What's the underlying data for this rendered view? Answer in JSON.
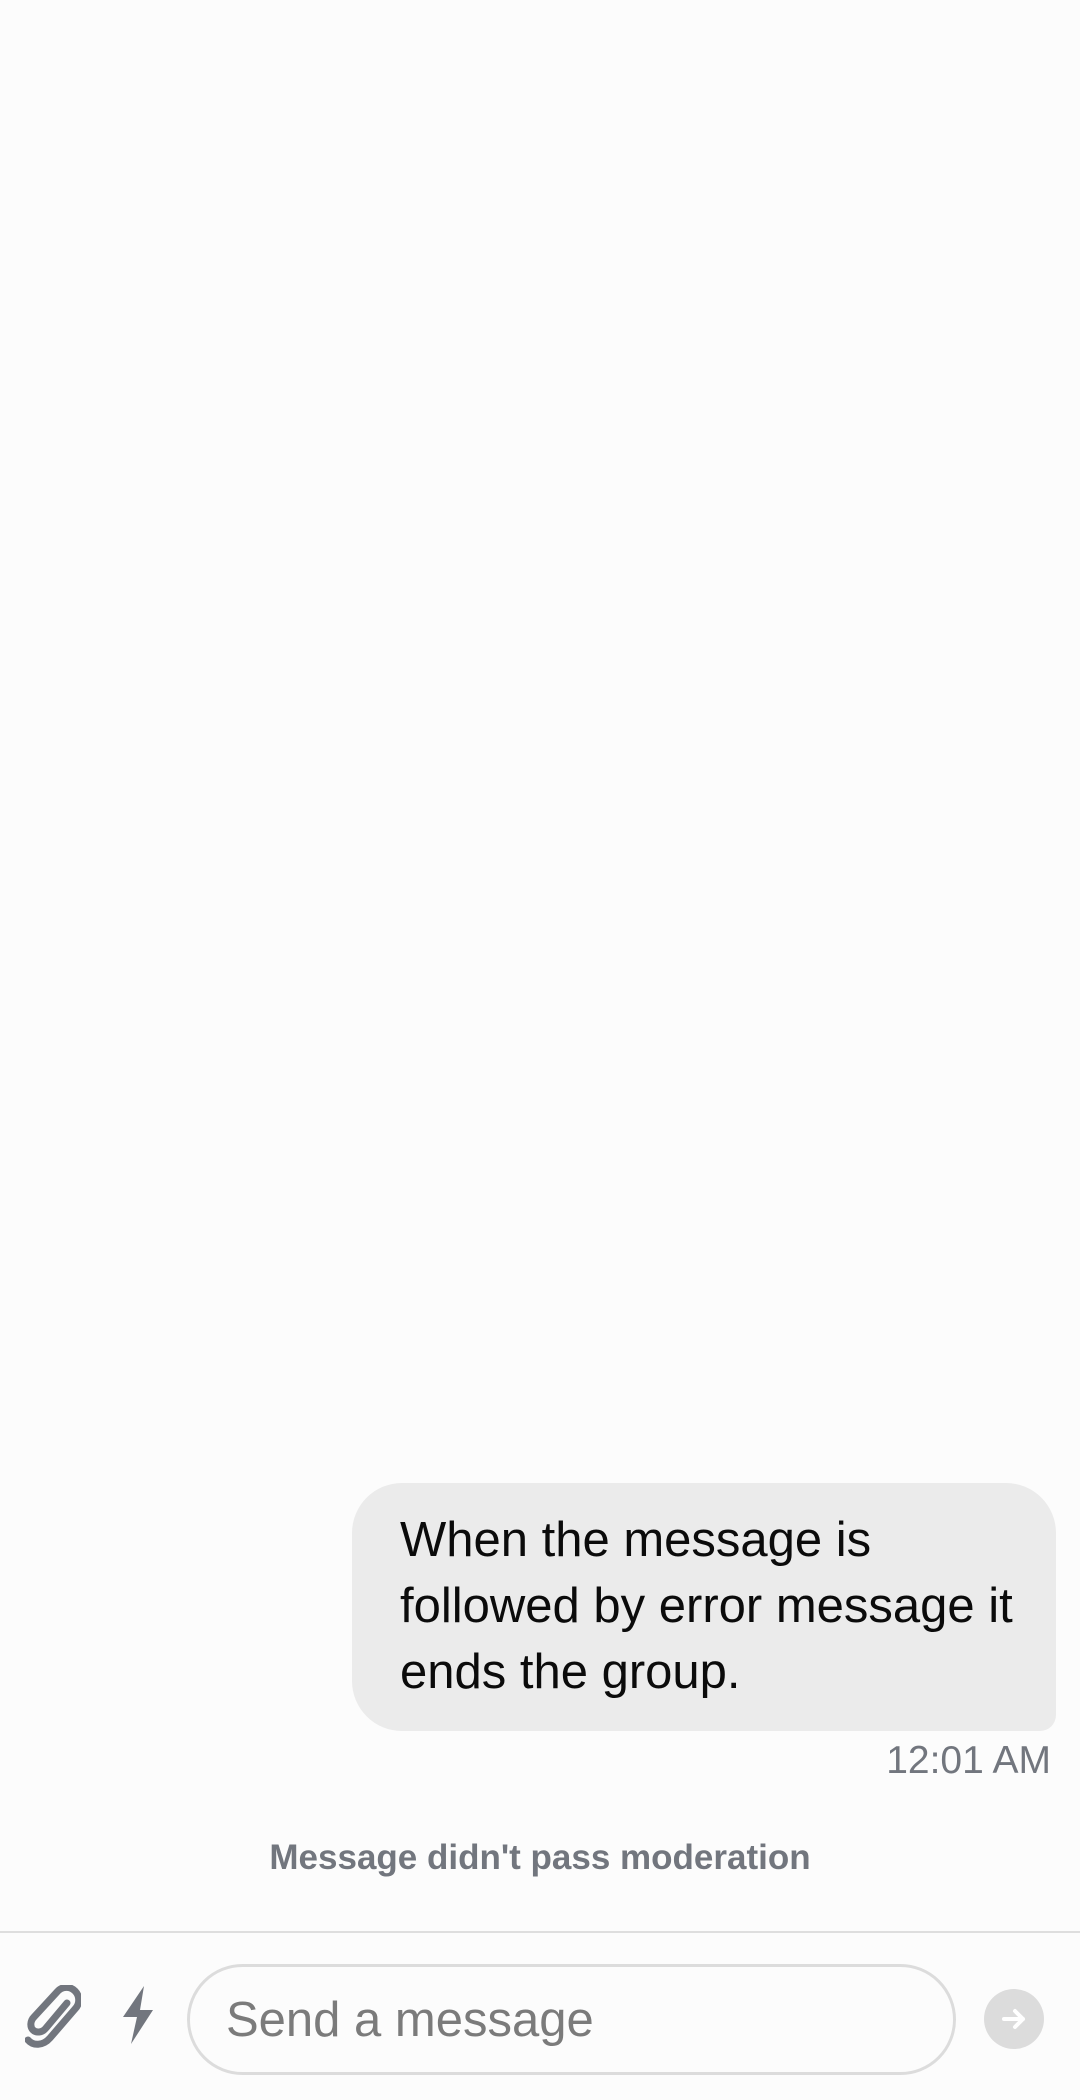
{
  "conversation": {
    "messages": [
      {
        "text": "When the message is followed by error message it ends the group.",
        "time": "12:01 AM"
      }
    ],
    "moderation_status": "Message didn't pass moderation"
  },
  "composer": {
    "placeholder": "Send a message",
    "value": "",
    "icons": {
      "attach": "paperclip-icon",
      "commands": "lightning-icon",
      "send": "arrow-right-icon"
    }
  },
  "colors": {
    "background": "#fcfcfc",
    "bubble": "#ebebeb",
    "muted_text": "#72767e",
    "icon": "#72767e",
    "send_button": "#dcdcdc"
  }
}
